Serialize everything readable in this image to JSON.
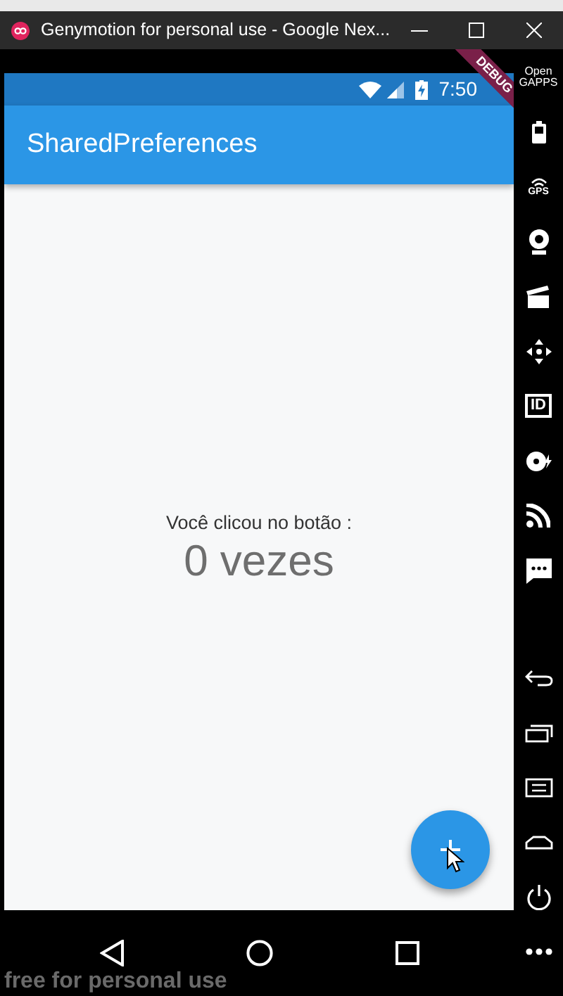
{
  "window": {
    "title": "Genymotion for personal use - Google Nex..."
  },
  "status_bar": {
    "time": "7:50"
  },
  "debug_banner": {
    "label": "DEBUG"
  },
  "app_bar": {
    "title": "SharedPreferences"
  },
  "body": {
    "label": "Você clicou no botão :",
    "count": "0 vezes"
  },
  "side_toolbar": {
    "gapps_label": [
      "Open",
      "GAPPS"
    ],
    "gps_label": "GPS",
    "id_label": "ID"
  },
  "overlay_text": "free for personal use"
}
